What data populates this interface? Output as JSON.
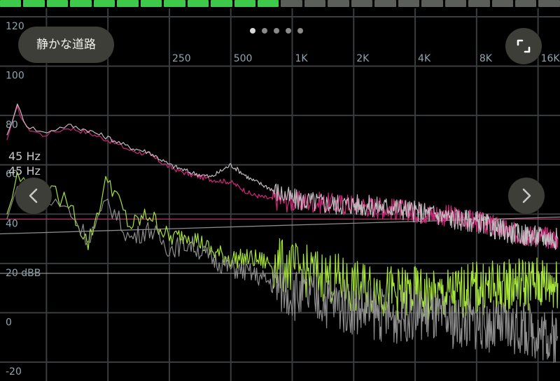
{
  "preset_pill": {
    "label": "静かな道路"
  },
  "page_indicator": {
    "count": 5,
    "active": 0
  },
  "level_meter": {
    "lit_segments": 12,
    "total_segments": 24,
    "lit_color": "#3ec94a",
    "dim_color": "#5c5f59"
  },
  "frequency_markers": [
    "45 Hz",
    "45 Hz"
  ],
  "icons": {
    "fullscreen": "expand-icon",
    "previous": "chevron-left-icon",
    "next": "chevron-right-icon"
  },
  "chart_data": {
    "type": "line",
    "x_scale": "log",
    "x_tick_labels": [
      "250",
      "500",
      "1K",
      "2K",
      "4K",
      "8K",
      "16K"
    ],
    "y_tick_labels": [
      "120",
      "100",
      "80",
      "60",
      "40",
      "20 dBB",
      "0",
      "-20"
    ],
    "ylim": [
      -20,
      120
    ],
    "grid": true,
    "reference_lines_db": [
      38,
      32,
      16
    ],
    "series": [
      {
        "color": "#d0287a",
        "x": [
          40,
          45,
          50,
          60,
          80,
          100,
          125,
          160,
          200,
          250,
          315,
          400,
          500,
          630,
          800,
          1000,
          1250,
          1600,
          2000,
          2500,
          3150,
          4000,
          5000,
          6300,
          8000,
          10000,
          12500,
          16000,
          20000
        ],
        "y": [
          70,
          83,
          75,
          72,
          75,
          73,
          70,
          66,
          64,
          59,
          56,
          54,
          53,
          48,
          46,
          45,
          45,
          44,
          44,
          43,
          42,
          41,
          40,
          39,
          37,
          35,
          32,
          31,
          30
        ]
      },
      {
        "color": "#c3bcc0",
        "x": [
          40,
          45,
          50,
          60,
          80,
          100,
          125,
          160,
          200,
          250,
          315,
          400,
          500,
          630,
          800,
          1000,
          1250,
          1600,
          2000,
          2500,
          3150,
          4000,
          5000,
          6300,
          8000,
          10000,
          12500,
          16000,
          20000
        ],
        "y": [
          72,
          84,
          76,
          73,
          76,
          74,
          71,
          67,
          65,
          60,
          57,
          55,
          60,
          54,
          50,
          46,
          45,
          44,
          44,
          43,
          43,
          41,
          40,
          38,
          37,
          34,
          32,
          31,
          30
        ]
      },
      {
        "color": "#a7e43a",
        "x": [
          40,
          45,
          50,
          60,
          80,
          100,
          125,
          160,
          200,
          250,
          315,
          400,
          500,
          630,
          800,
          1000,
          1250,
          1600,
          2000,
          2500,
          3150,
          4000,
          5000,
          6300,
          8000,
          10000,
          12500,
          16000,
          20000
        ],
        "y": [
          40,
          55,
          52,
          50,
          45,
          28,
          55,
          35,
          40,
          30,
          32,
          25,
          22,
          22,
          20,
          18,
          16,
          14,
          10,
          10,
          8,
          8,
          6,
          8,
          10,
          10,
          12,
          12,
          12
        ]
      },
      {
        "color": "#8d8d8d",
        "x": [
          40,
          45,
          50,
          60,
          80,
          100,
          125,
          160,
          200,
          250,
          315,
          400,
          500,
          630,
          800,
          1000,
          1250,
          1600,
          2000,
          2500,
          3150,
          4000,
          5000,
          6300,
          8000,
          10000,
          12500,
          16000,
          20000
        ],
        "y": [
          38,
          50,
          48,
          46,
          42,
          30,
          45,
          30,
          34,
          26,
          28,
          22,
          18,
          16,
          12,
          8,
          6,
          4,
          2,
          0,
          -2,
          0,
          -2,
          -4,
          -4,
          -6,
          -6,
          -8,
          -10
        ]
      }
    ]
  }
}
